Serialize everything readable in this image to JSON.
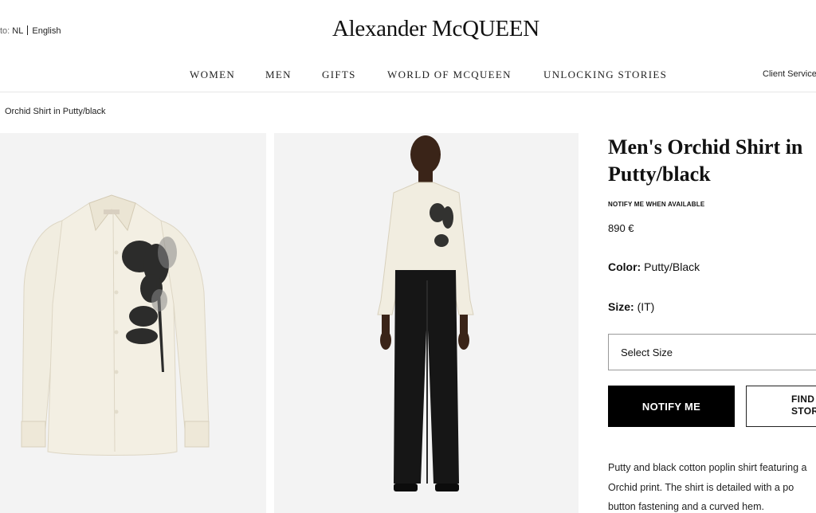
{
  "locale": {
    "prefix": "to:",
    "country": "NL",
    "language": "English"
  },
  "brand": {
    "logo_text": "Alexander McQUEEN"
  },
  "header": {
    "client_service": "Client Service"
  },
  "nav": {
    "items": [
      {
        "label": "WOMEN"
      },
      {
        "label": "MEN"
      },
      {
        "label": "GIFTS"
      },
      {
        "label": "WORLD OF MCQUEEN"
      },
      {
        "label": "UNLOCKING STORIES"
      }
    ]
  },
  "breadcrumb": {
    "current": "Orchid Shirt in Putty/black"
  },
  "product": {
    "title": "Men's Orchid Shirt in Putty/black",
    "availability": "NOTIFY ME WHEN AVAILABLE",
    "price": "890 €",
    "color_label": "Color:",
    "color_value": "Putty/Black",
    "size_label": "Size:",
    "size_value": "(IT)",
    "size_select_placeholder": "Select Size",
    "notify_button": "NOTIFY ME",
    "find_store_line1": "FIND",
    "find_store_line2": "STOR",
    "description_lines": [
      "Putty and black cotton poplin shirt featuring a",
      "Orchid print. The shirt is detailed with a po",
      "button fastening and a curved hem."
    ]
  },
  "colors": {
    "panel_bg": "#f3f3f3",
    "shirt": "#f1ede0",
    "button_bg": "#000000"
  }
}
